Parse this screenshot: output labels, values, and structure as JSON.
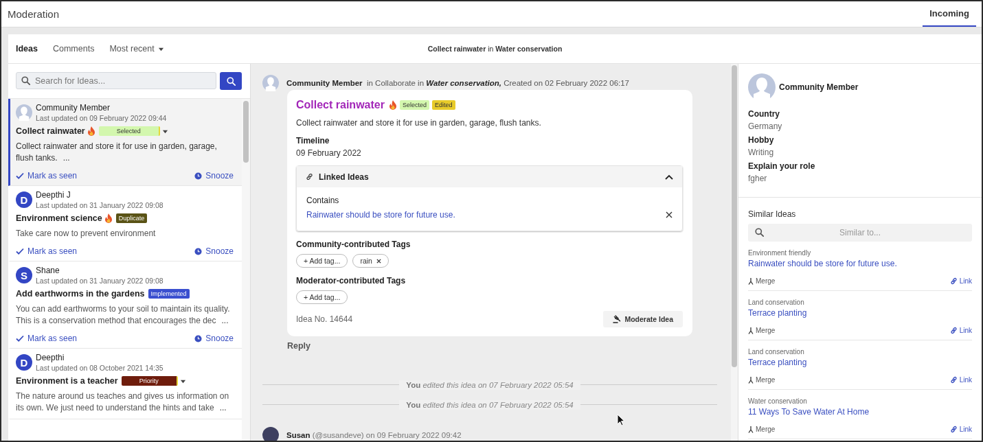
{
  "header": {
    "title": "Moderation",
    "tabs": [
      {
        "label": "Incoming",
        "selected": true
      }
    ]
  },
  "toolbar": {
    "tabs": [
      {
        "label": "Ideas",
        "selected": true,
        "kind": "tab"
      },
      {
        "label": "Comments",
        "selected": false,
        "kind": "tab"
      },
      {
        "label": "Most recent",
        "selected": false,
        "kind": "dropdown"
      }
    ],
    "context": "**Collect rainwater** in **Water conservation**"
  },
  "search": {
    "placeholder": "Search for Ideas..."
  },
  "ideas": [
    {
      "author": "Community Member",
      "avatar": {
        "kind": "silhouette"
      },
      "updated": "Last updated on 09 February 2022 09:44",
      "title": "Collect rainwater",
      "hot": true,
      "badges": [
        {
          "label": "Selected",
          "color": "#d3f7ae"
        }
      ],
      "has_dropdown": true,
      "body": "Collect rainwater and store it for use in garden, garage, flush tanks.",
      "more": "...",
      "actions": [
        "Mark as seen",
        "Snooze"
      ],
      "selected": true
    },
    {
      "author": "Deepthi J",
      "avatar": {
        "kind": "letter",
        "letter": "D"
      },
      "updated": "Last updated on 31 January 2022 09:08",
      "title": "Environment science",
      "hot": true,
      "badges": [
        {
          "label": "Duplicate",
          "color": "#5a5316"
        }
      ],
      "has_dropdown": false,
      "body": "Take care now to prevent environment",
      "actions": [
        "Mark as seen",
        "Snooze"
      ],
      "selected": false
    },
    {
      "author": "Shane",
      "avatar": {
        "kind": "letter",
        "letter": "S"
      },
      "updated": "Last updated on 31 January 2022 09:08",
      "title": "Add earthworms in the gardens",
      "hot": false,
      "badges": [
        {
          "label": "Implemented",
          "color": "#3a4fcf"
        }
      ],
      "has_dropdown": false,
      "body": "You can add earthworms to your soil to maintain its quality. This is a conservation method that encourages the dec",
      "more": "...",
      "actions": [
        "Mark as seen",
        "Snooze"
      ],
      "selected": false
    },
    {
      "author": "Deepthi",
      "avatar": {
        "kind": "letter",
        "letter": "D"
      },
      "updated": "Last updated on 08 October 2021 14:35",
      "title": "Environment is a teacher",
      "hot": false,
      "badges": [
        {
          "label": "Priority",
          "color": "#6e1c0c"
        }
      ],
      "has_dropdown": true,
      "body": "The nature around us teaches and gives us information on its own. We just need to understand the hints and take",
      "more": "...",
      "selected": false
    }
  ],
  "detail": {
    "author": "Community Member",
    "context_prefix": "in Collaborate in",
    "community": "Water conservation,",
    "created": "Created on 02 February 2022 06:17",
    "title": "Collect rainwater",
    "hot": true,
    "badges": [
      {
        "label": "Selected",
        "color": "#d3f7ae"
      },
      {
        "label": "Edited",
        "color": "#e8cb2a"
      }
    ],
    "description": "Collect rainwater and store it for use in garden, garage, flush tanks.",
    "timeline": {
      "label": "Timeline",
      "value": "09 February 2022"
    },
    "linked": {
      "title": "Linked Ideas",
      "expanded": true,
      "relation": "Contains",
      "link": "Rainwater should be store for future use."
    },
    "community_tags": {
      "label": "Community-contributed Tags",
      "add": "+ Add tag...",
      "tags": [
        "rain"
      ]
    },
    "moderator_tags": {
      "label": "Moderator-contributed Tags",
      "add": "+ Add tag..."
    },
    "idea_no": "Idea No. 14644",
    "moderate": "Moderate Idea",
    "reply": "Reply",
    "events": [
      {
        "actor": "You",
        "text": "edited this idea on 07 February 2022 05:54"
      },
      {
        "actor": "You",
        "text": "edited this idea on 07 February 2022 05:54"
      }
    ],
    "comment": {
      "author": "Susan",
      "text": "(@susandeve) on 09 February 2022 09:42"
    }
  },
  "profile": {
    "name": "Community Member",
    "fields": [
      {
        "label": "Country",
        "value": "Germany"
      },
      {
        "label": "Hobby",
        "value": "Writing"
      },
      {
        "label": "Explain your role",
        "value": "fgher"
      }
    ]
  },
  "similar": {
    "title": "Similar Ideas",
    "placeholder": "Similar to...",
    "items": [
      {
        "category": "Environment friendly",
        "title": "Rainwater should be store for future use.",
        "merge": "Merge",
        "link": "Link"
      },
      {
        "category": "Land conservation",
        "title": "Terrace planting",
        "merge": "Merge",
        "link": "Link"
      },
      {
        "category": "Land conservation",
        "title": "Terrace planting",
        "merge": "Merge",
        "link": "Link"
      },
      {
        "category": "Water conservation",
        "title": "11 Ways To Save Water At Home",
        "merge": "Merge",
        "link": "Link"
      }
    ]
  }
}
